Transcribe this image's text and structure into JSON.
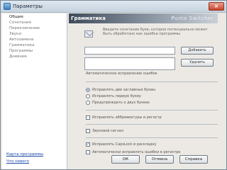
{
  "window": {
    "title": "Параметры",
    "close_glyph": "×"
  },
  "sidebar": {
    "items": [
      {
        "label": "Общие",
        "active": true
      },
      {
        "label": "Сочетания",
        "active": false
      },
      {
        "label": "Переключение",
        "active": false
      },
      {
        "label": "Звуки",
        "active": false
      },
      {
        "label": "Автозамена",
        "active": false
      },
      {
        "label": "Грамматика",
        "active": false
      },
      {
        "label": "Программы",
        "active": false
      },
      {
        "label": "Дневник",
        "active": false
      }
    ],
    "links": [
      "Карта программы",
      "Что нового"
    ]
  },
  "section": {
    "title": "Грамматика",
    "brand": "Punto Switcher"
  },
  "description": "Введите сочетание букв, которое потенциально может быть обработано как ошибка программы",
  "buttons": {
    "add": "Добавить",
    "edit": "Удалить"
  },
  "group_label": "Автоматическое исправление ошибок",
  "radios": [
    {
      "label": "Исправлять две заглавные буквы",
      "selected": true
    },
    {
      "label": "Исправлять первую букву",
      "selected": false
    },
    {
      "label": "Предупреждать о двух буквах",
      "selected": false
    }
  ],
  "checkboxes": [
    {
      "label": "Исправлять аббревиатуры и регистр",
      "checked": false
    },
    {
      "label": "Звуковой сигнал",
      "checked": false
    },
    {
      "label": "Исправлять CapsLock и раскладку",
      "checked": true
    },
    {
      "label": "Автоматически исправлять ошибки в регистре",
      "checked": false
    }
  ],
  "footer": {
    "ok": "ОК",
    "cancel": "Отмена",
    "apply": "Справка"
  }
}
